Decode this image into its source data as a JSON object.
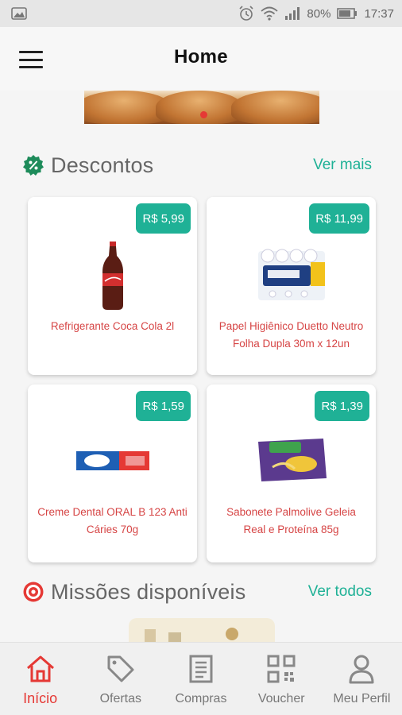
{
  "status_bar": {
    "battery": "80%",
    "time": "17:37",
    "icons": [
      "image-icon",
      "alarm-icon",
      "wifi-icon",
      "signal-icon",
      "battery-icon"
    ]
  },
  "header": {
    "title": "Home",
    "menu_icon": "menu-icon"
  },
  "banner": {
    "active_dot": 1
  },
  "descontos": {
    "title": "Descontos",
    "link": "Ver mais",
    "icon": "percent-badge-icon",
    "products": [
      {
        "price": "R$ 5,99",
        "name": "Refrigerante Coca Cola 2l"
      },
      {
        "price": "R$ 11,99",
        "name": "Papel Higiênico Duetto Neutro Folha Dupla 30m x 12un"
      },
      {
        "price": "R$ 1,59",
        "name": "Creme Dental ORAL B 123 Anti Cáries 70g"
      },
      {
        "price": "R$ 1,39",
        "name": "Sabonete Palmolive Geleia Real e Proteína 85g"
      }
    ]
  },
  "missoes": {
    "title": "Missões disponíveis",
    "link": "Ver todos",
    "icon": "target-icon"
  },
  "bottom_nav": {
    "items": [
      {
        "label": "Início",
        "icon": "home-icon",
        "active": true
      },
      {
        "label": "Ofertas",
        "icon": "tag-icon",
        "active": false
      },
      {
        "label": "Compras",
        "icon": "receipt-icon",
        "active": false
      },
      {
        "label": "Voucher",
        "icon": "qrcode-icon",
        "active": false
      },
      {
        "label": "Meu Perfil",
        "icon": "user-icon",
        "active": false
      }
    ]
  },
  "colors": {
    "accent": "#1fb196",
    "brand_red": "#e53935",
    "product_text": "#d64545"
  }
}
